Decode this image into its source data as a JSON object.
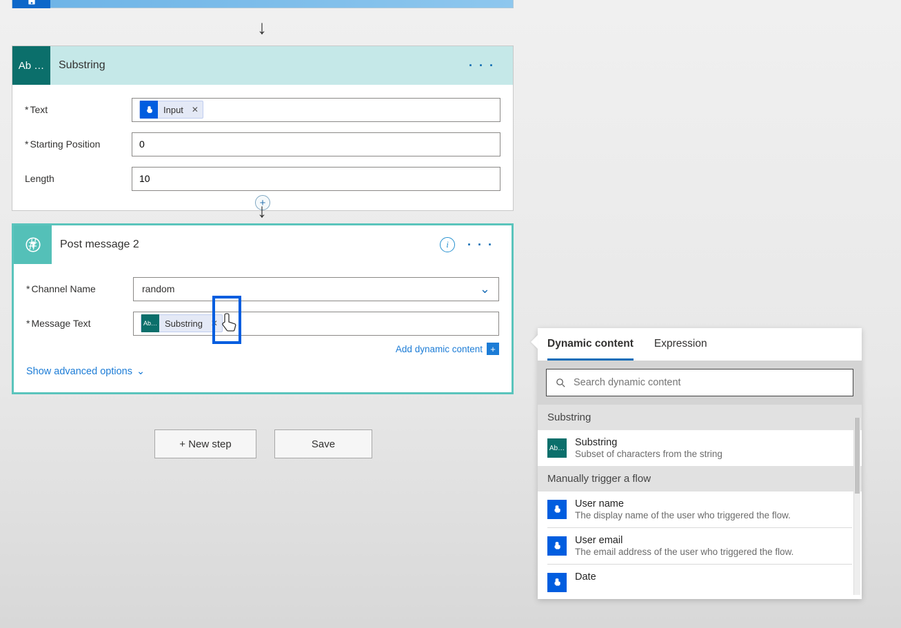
{
  "cards": {
    "substring": {
      "icon_label": "Ab …",
      "title": "Substring",
      "fields": {
        "text": {
          "label": "Text",
          "token": "Input"
        },
        "start": {
          "label": "Starting Position",
          "value": "0"
        },
        "length": {
          "label": "Length",
          "value": "10"
        }
      }
    },
    "post": {
      "title": "Post message 2",
      "fields": {
        "channel": {
          "label": "Channel Name",
          "value": "random"
        },
        "message": {
          "label": "Message Text",
          "token": "Substring"
        }
      },
      "add_dc": "Add dynamic content",
      "show_advanced": "Show advanced options"
    }
  },
  "footer": {
    "new_step": "+ New step",
    "save": "Save"
  },
  "dc_panel": {
    "tabs": {
      "dynamic": "Dynamic content",
      "expression": "Expression"
    },
    "search_placeholder": "Search dynamic content",
    "sections": [
      {
        "title": "Substring",
        "items": [
          {
            "icon": "teal",
            "title": "Substring",
            "desc": "Subset of characters from the string"
          }
        ]
      },
      {
        "title": "Manually trigger a flow",
        "items": [
          {
            "icon": "blue",
            "title": "User name",
            "desc": "The display name of the user who triggered the flow."
          },
          {
            "icon": "blue",
            "title": "User email",
            "desc": "The email address of the user who triggered the flow."
          },
          {
            "icon": "blue",
            "title": "Date",
            "desc": ""
          }
        ]
      }
    ]
  }
}
